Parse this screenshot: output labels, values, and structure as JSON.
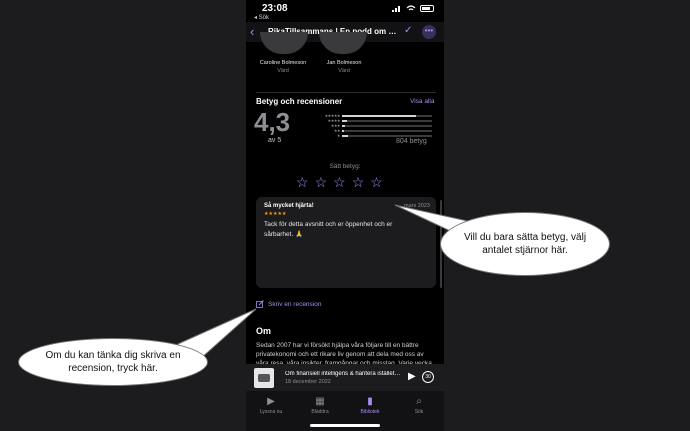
{
  "status_bar": {
    "time": "23:08",
    "back_app": "◂ Sök"
  },
  "nav": {
    "title": "RikaTillsammans | En podd om pri…"
  },
  "hosts": [
    {
      "name": "Caroline Bolmeson",
      "role": "Värd"
    },
    {
      "name": "Jan Bolmeson",
      "role": "Värd"
    }
  ],
  "ratings": {
    "title": "Betyg och recensioner",
    "see_all": "Visa alla",
    "average": "4,3",
    "of_label": "av 5",
    "count": "804 betyg",
    "distribution": [
      0.82,
      0.06,
      0.03,
      0.02,
      0.07
    ],
    "tap_label": "Sätt betyg:"
  },
  "review": {
    "title": "Så mycket hjärta!",
    "date": "mars 2023",
    "stars": "★★★★★",
    "body": "Tack för detta avsnitt och er öppenhet och er sårbarhet. 🙏"
  },
  "write_review": "Skriv en recension",
  "about": {
    "title": "Om",
    "body": "Sedan 2007 har vi försökt hjälpa våra följare till en bättre privatekonomi och ett rikare liv genom att dela med oss av våra resa, våra insikter, framgångar och misstag. Varje vecka"
  },
  "player": {
    "episode_title": "Om finansiell intelligens & hantera istället…",
    "date": "18 december 2022",
    "skip_label": "30"
  },
  "tabs": [
    {
      "label": "Lyssna nu",
      "icon": "play-circle-icon"
    },
    {
      "label": "Bläddra",
      "icon": "grid-icon"
    },
    {
      "label": "Bibliotek",
      "icon": "library-icon"
    },
    {
      "label": "Sök",
      "icon": "search-icon"
    }
  ],
  "callouts": {
    "right": "Vill du bara sätta betyg, välj antalet stjärnor här.",
    "left": "Om du kan tänka dig skriva en recension, tryck här."
  },
  "colors": {
    "accent": "#a98cf2",
    "background": "#000000",
    "star_orange": "#ff9f0a"
  }
}
